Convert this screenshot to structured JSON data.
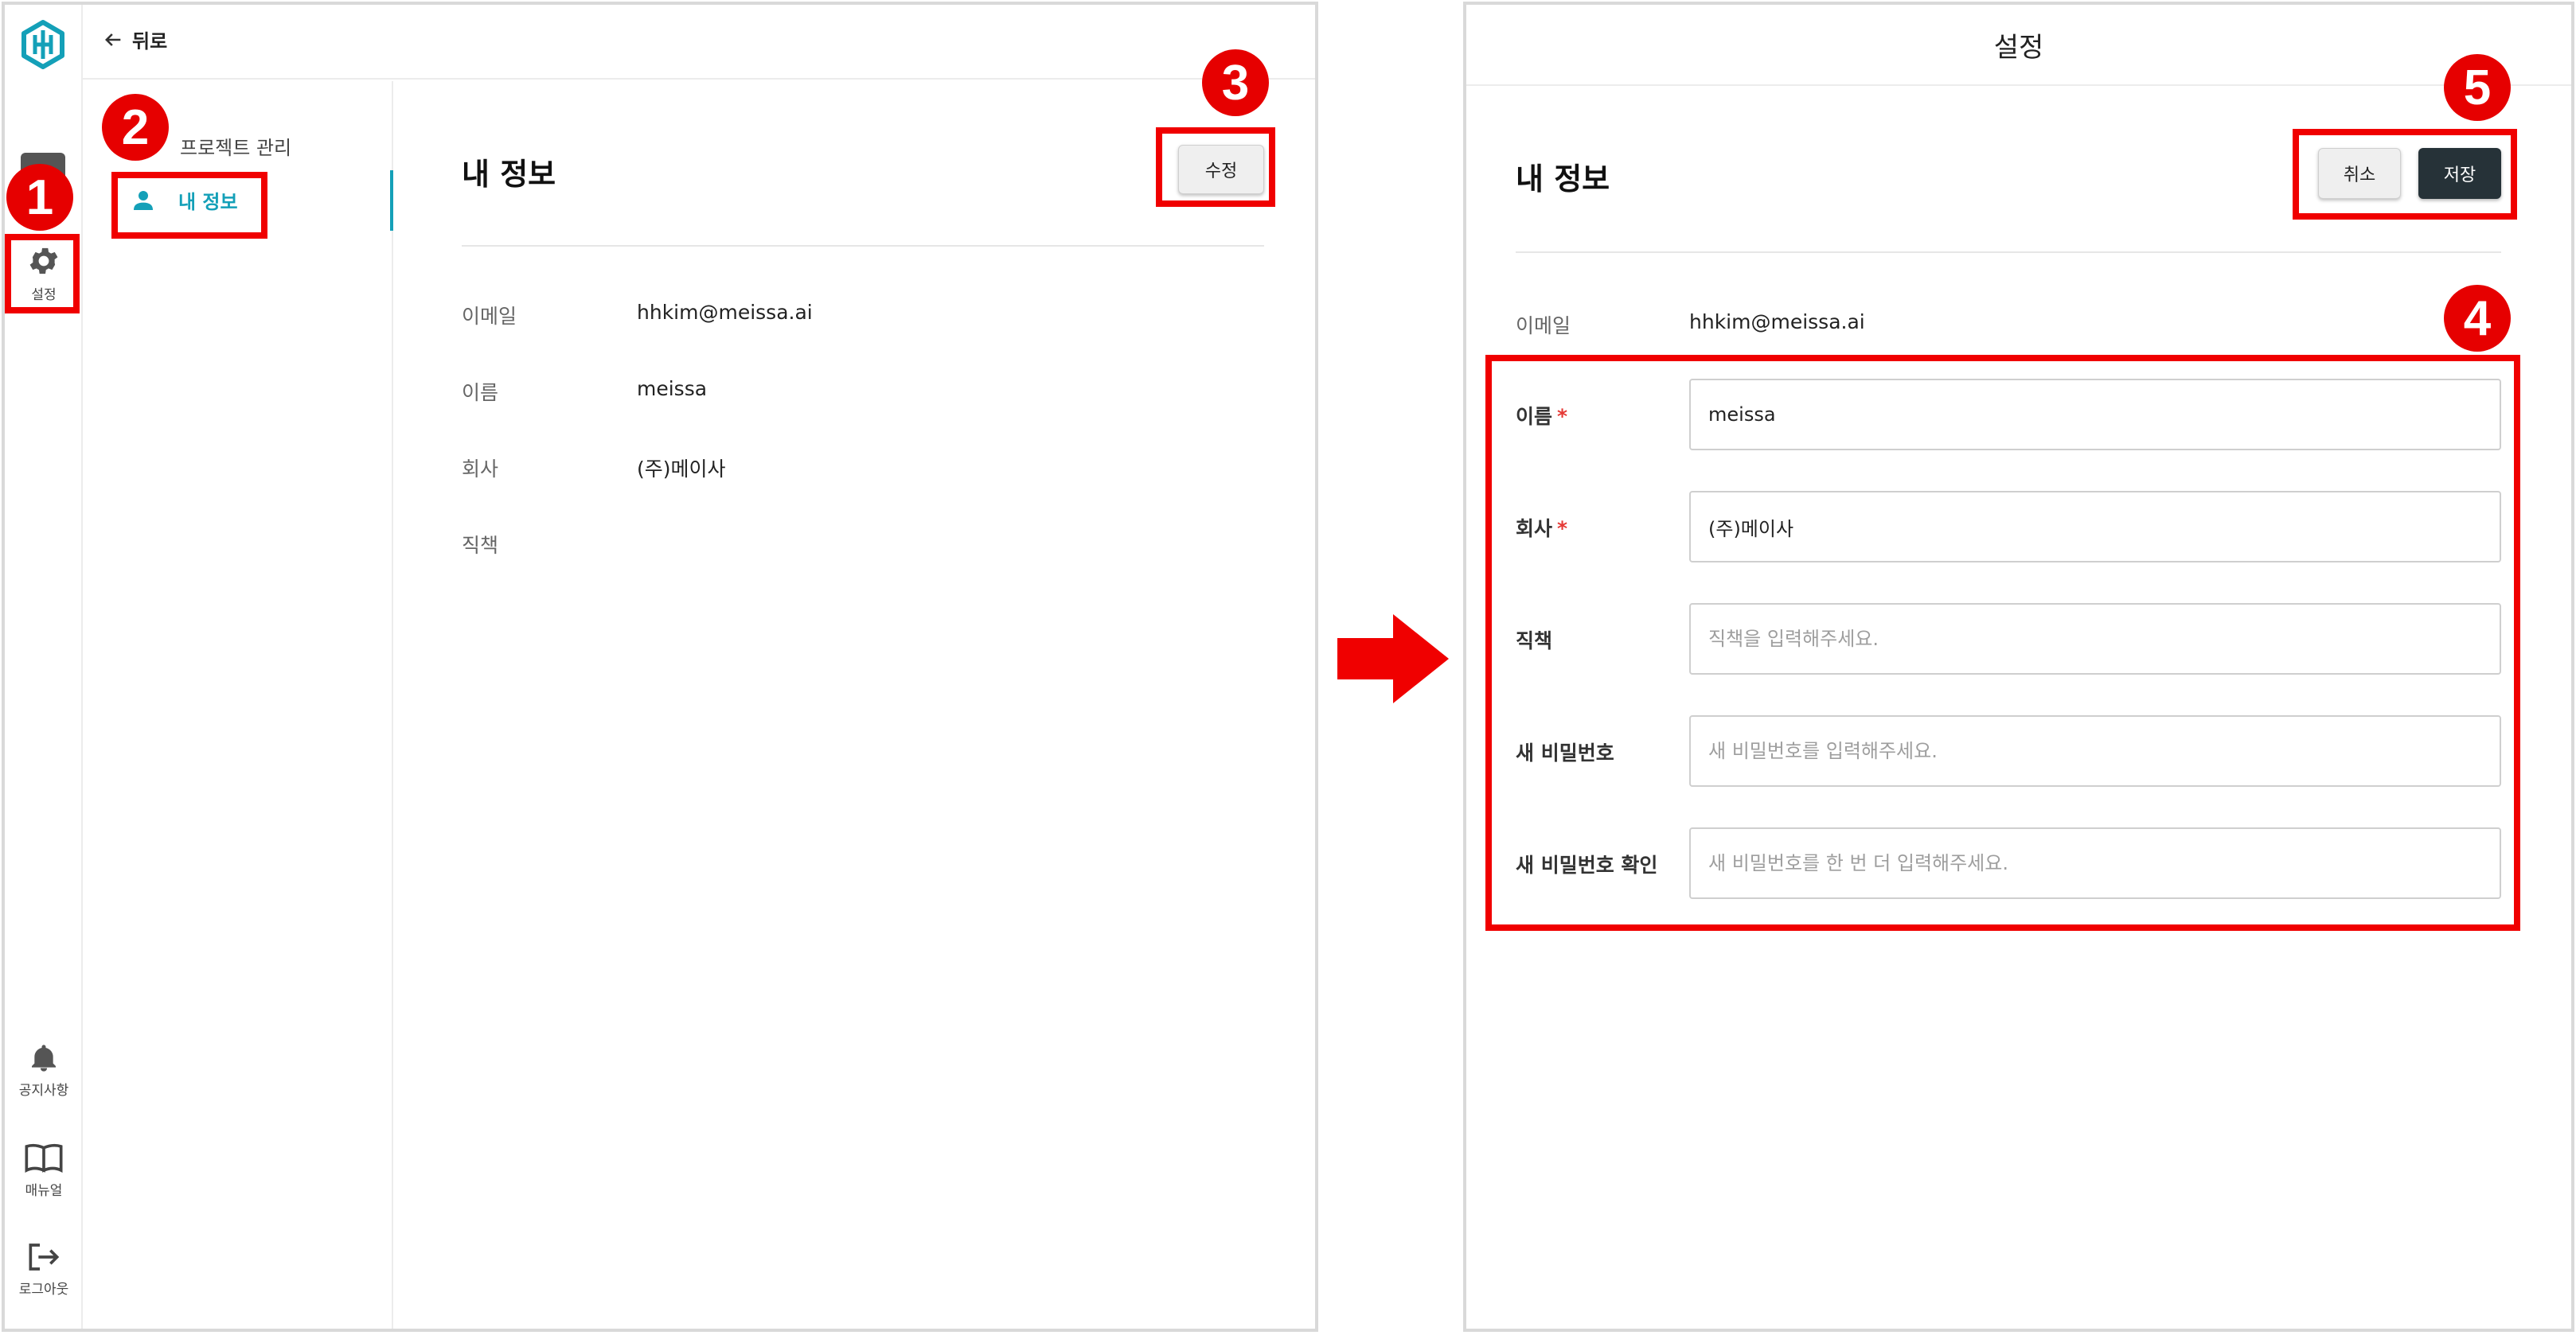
{
  "left_screen": {
    "rail": {
      "items": [
        {
          "label": "설정",
          "icon": "gear-icon"
        },
        {
          "label": "공지사항",
          "icon": "bell-icon"
        },
        {
          "label": "매뉴얼",
          "icon": "book-icon"
        },
        {
          "label": "로그아웃",
          "icon": "logout-icon"
        }
      ]
    },
    "topbar": {
      "back_label": "뒤로"
    },
    "subnav": {
      "section_label": "프로젝트 관리",
      "active_item_label": "내 정보"
    },
    "content": {
      "title": "내 정보",
      "edit_label": "수정",
      "fields": [
        {
          "label": "이메일",
          "value": "hhkim@meissa.ai"
        },
        {
          "label": "이름",
          "value": "meissa"
        },
        {
          "label": "회사",
          "value": "(주)메이사"
        },
        {
          "label": "직책",
          "value": ""
        }
      ]
    }
  },
  "right_screen": {
    "header_title": "설정",
    "title": "내 정보",
    "cancel_label": "취소",
    "save_label": "저장",
    "email": {
      "label": "이메일",
      "value": "hhkim@meissa.ai"
    },
    "form": [
      {
        "label": "이름",
        "required": "*",
        "value": "meissa",
        "placeholder": ""
      },
      {
        "label": "회사",
        "required": "*",
        "value": "(주)메이사",
        "placeholder": ""
      },
      {
        "label": "직책",
        "required": "",
        "value": "",
        "placeholder": "직책을 입력해주세요."
      },
      {
        "label": "새 비밀번호",
        "required": "",
        "value": "",
        "placeholder": "새 비밀번호를 입력해주세요."
      },
      {
        "label": "새 비밀번호 확인",
        "required": "",
        "value": "",
        "placeholder": "새 비밀번호를 한 번 더 입력해주세요."
      }
    ]
  },
  "annotations": {
    "steps": [
      "1",
      "2",
      "3",
      "4",
      "5"
    ],
    "color": "#e60000"
  },
  "colors": {
    "accent": "#14a0b8",
    "save_button": "#263238",
    "annotation": "#f00000"
  }
}
